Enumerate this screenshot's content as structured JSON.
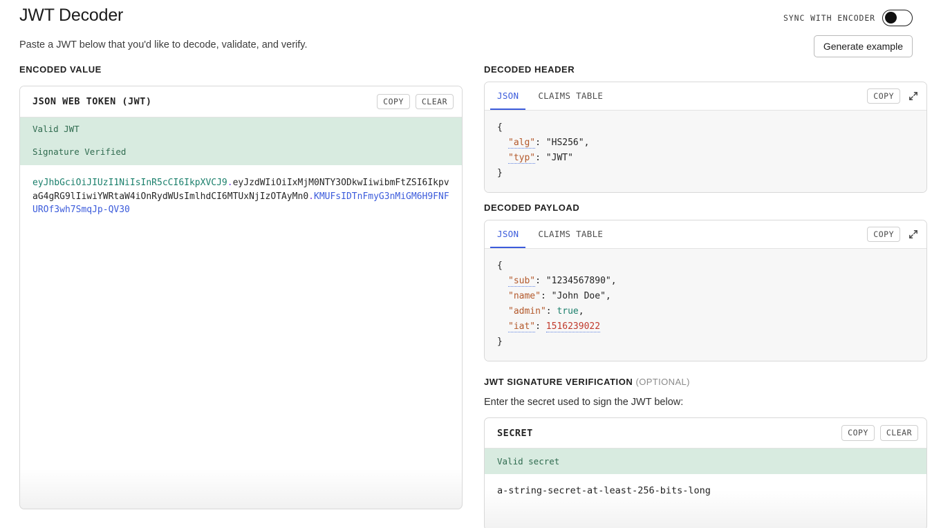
{
  "header": {
    "title": "JWT Decoder",
    "subtitle": "Paste a JWT below that you'd like to decode, validate, and verify.",
    "sync_label": "SYNC WITH ENCODER",
    "sync_enabled": false,
    "generate_button": "Generate example"
  },
  "left": {
    "section_label": "ENCODED VALUE",
    "card_title": "JSON WEB TOKEN (JWT)",
    "copy_label": "COPY",
    "clear_label": "CLEAR",
    "status_valid": "Valid JWT",
    "status_signature": "Signature Verified",
    "token": {
      "header_part": "eyJhbGciOiJIUzI1NiIsInR5cCI6IkpXVCJ9",
      "payload_part": "eyJzdWIiOiIxMjM0NTY3ODkwIiwibmFtZSI6IkpvaG4gRG9lIiwiYWRtaW4iOnRydWUsImlhdCI6MTUxNjIzOTAyMn0",
      "signature_part": "KMUFsIDTnFmyG3nMiGM6H9FNFUROf3wh7SmqJp-QV30",
      "separator": "."
    }
  },
  "decoded_header": {
    "section_label": "DECODED HEADER",
    "tabs": [
      {
        "label": "JSON",
        "active": true
      },
      {
        "label": "CLAIMS TABLE",
        "active": false
      }
    ],
    "copy_label": "COPY",
    "expand_icon": "expand-diagonal-icon",
    "json": {
      "open_brace": "{",
      "close_brace": "}",
      "rows": [
        {
          "key": "\"alg\"",
          "colon": ": ",
          "value": "\"HS256\"",
          "comma": ",",
          "value_type": "string",
          "key_hint": true
        },
        {
          "key": "\"typ\"",
          "colon": ": ",
          "value": "\"JWT\"",
          "comma": "",
          "value_type": "string",
          "key_hint": true
        }
      ]
    }
  },
  "decoded_payload": {
    "section_label": "DECODED PAYLOAD",
    "tabs": [
      {
        "label": "JSON",
        "active": true
      },
      {
        "label": "CLAIMS TABLE",
        "active": false
      }
    ],
    "copy_label": "COPY",
    "expand_icon": "expand-diagonal-icon",
    "json": {
      "open_brace": "{",
      "close_brace": "}",
      "rows": [
        {
          "key": "\"sub\"",
          "colon": ": ",
          "value": "\"1234567890\"",
          "comma": ",",
          "value_type": "string",
          "key_hint": true
        },
        {
          "key": "\"name\"",
          "colon": ": ",
          "value": "\"John Doe\"",
          "comma": ",",
          "value_type": "string",
          "key_hint": false
        },
        {
          "key": "\"admin\"",
          "colon": ": ",
          "value": "true",
          "comma": ",",
          "value_type": "boolean",
          "key_hint": false
        },
        {
          "key": "\"iat\"",
          "colon": ": ",
          "value": "1516239022",
          "comma": "",
          "value_type": "number",
          "key_hint": true
        }
      ]
    }
  },
  "signature_verification": {
    "section_label": "JWT SIGNATURE VERIFICATION",
    "optional_label": "(OPTIONAL)",
    "help_text": "Enter the secret used to sign the JWT below:",
    "card_title": "SECRET",
    "copy_label": "COPY",
    "clear_label": "CLEAR",
    "status_valid": "Valid secret",
    "secret_value": "a-string-secret-at-least-256-bits-long"
  },
  "colors": {
    "accent_blue": "#3b5bdb",
    "valid_bg": "#d8ebe0",
    "valid_text": "#2f6b4f",
    "json_key": "#b3582a",
    "json_bool": "#1a7f6b",
    "json_number": "#c0392b",
    "token_header": "#1a7f6b",
    "token_signature": "#3b5bdb",
    "token_dot": "#7b3fe4"
  }
}
